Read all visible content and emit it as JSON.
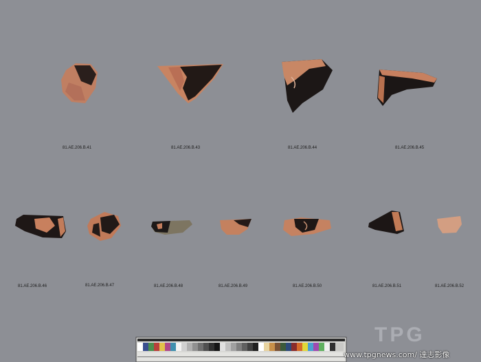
{
  "labels": {
    "l41": "81.AE.206.B.41",
    "l43": "81.AE.206.B.43",
    "l44": "81.AE.206.B.44",
    "l45": "81.AE.206.B.45",
    "l46": "81.AE.206.B.46",
    "l47": "81.AE.206.B.47",
    "l48": "81.AE.206.B.48",
    "l49": "81.AE.206.B.49",
    "l50": "81.AE.206.B.50",
    "l51": "81.AE.206.B.51",
    "l52": "81.AE.206.B.52"
  },
  "watermark": {
    "logo": "TPG",
    "credit": "www.tpgnews.com/ 達志影像"
  },
  "colors": {
    "background": "#8d8f95",
    "terracotta": "#c98563",
    "black_glaze": "#1b1616"
  }
}
